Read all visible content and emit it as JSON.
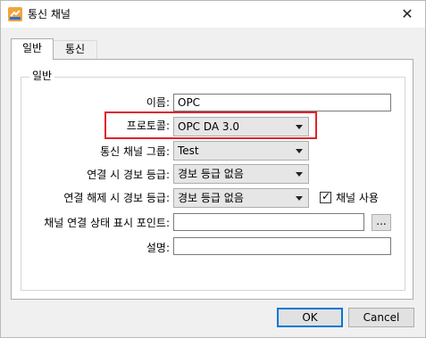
{
  "window": {
    "title": "통신 채널",
    "close_glyph": "✕"
  },
  "tabs": [
    {
      "label": "일반",
      "active": true
    },
    {
      "label": "통신",
      "active": false
    }
  ],
  "group": {
    "title": "일반"
  },
  "form": {
    "name": {
      "label": "이름:",
      "value": "OPC"
    },
    "protocol": {
      "label": "프로토콜:",
      "value": "OPC DA 3.0"
    },
    "channel_group": {
      "label": "통신 채널 그룹:",
      "value": "Test"
    },
    "connect_alarm": {
      "label": "연결 시 경보 등급:",
      "value": "경보 등급 없음"
    },
    "disconnect_alarm": {
      "label": "연결 해제 시 경보 등급:",
      "value": "경보 등급 없음"
    },
    "use_channel": {
      "label": "채널 사용",
      "checked": true
    },
    "status_point": {
      "label": "채널 연결 상태 표시 포인트:",
      "value": "",
      "browse_label": "..."
    },
    "description": {
      "label": "설명:",
      "value": ""
    }
  },
  "buttons": {
    "ok": "OK",
    "cancel": "Cancel"
  },
  "colors": {
    "highlight": "#e0232b",
    "focus_border": "#0078d7"
  },
  "icons": {
    "app": "channel-app-icon",
    "close": "close-icon",
    "dropdown": "chevron-down-icon",
    "check": "check-icon"
  }
}
